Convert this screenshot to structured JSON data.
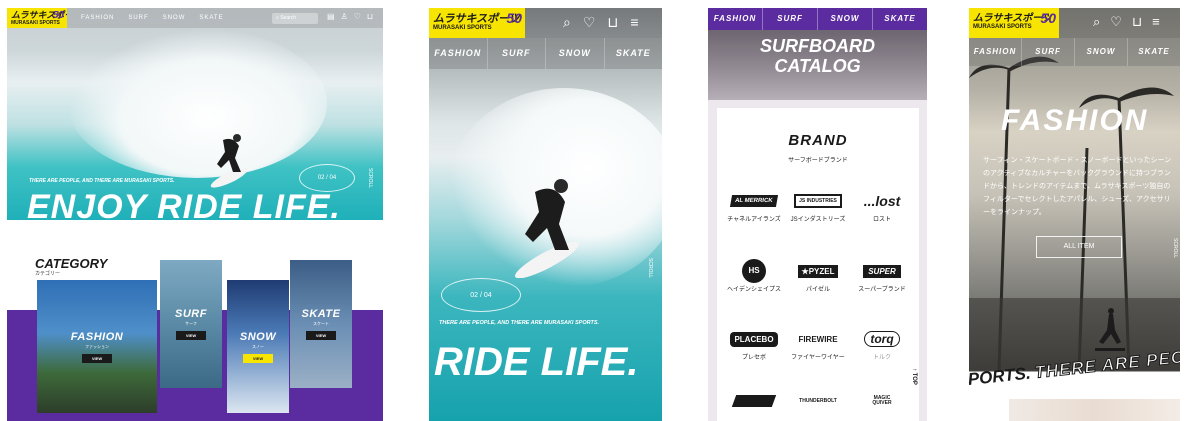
{
  "logo": {
    "jp": "ムラサキスポーツ",
    "en": "MURASAKI SPORTS",
    "anniv": "50"
  },
  "colors": {
    "brand_yellow": "#f7e400",
    "brand_purple": "#5b2ca0",
    "ocean": "#1fb0b9"
  },
  "desktop": {
    "nav": [
      "FASHION",
      "SURF",
      "SNOW",
      "SKATE"
    ],
    "search_placeholder": "Search",
    "tagline": "THERE ARE PEOPLE, AND THERE ARE MURASAKI SPORTS.",
    "headline": "ENJOY RIDE LIFE.",
    "pager": "02 / 04",
    "scroll": "SCROLL",
    "category": {
      "title": "CATEGORY",
      "subtitle": "カテゴリー"
    },
    "cards": [
      {
        "name": "FASHION",
        "sub": "ファッション",
        "view": "VIEW"
      },
      {
        "name": "SURF",
        "sub": "サーフ",
        "view": "VIEW"
      },
      {
        "name": "SNOW",
        "sub": "スノー",
        "view": "VIEW"
      },
      {
        "name": "SKATE",
        "sub": "スケート",
        "view": "VIEW"
      }
    ]
  },
  "mobile_home": {
    "tabs": [
      "FASHION",
      "SURF",
      "SNOW",
      "SKATE"
    ],
    "pager": "02 / 04",
    "scroll": "SCROLL",
    "tagline": "THERE ARE PEOPLE, AND THERE ARE MURASAKI SPORTS.",
    "headline": "RIDE LIFE."
  },
  "catalog": {
    "tabs": [
      "FASHION",
      "SURF",
      "SNOW",
      "SKATE"
    ],
    "title_line1": "SURFBOARD",
    "title_line2": "CATALOG",
    "brand_title": "BRAND",
    "brand_subtitle": "サーフボードブランド",
    "brands": [
      {
        "logo": "AL MERRICK",
        "name": "チャネルアイランズ"
      },
      {
        "logo": "JS INDUSTRIES",
        "name": "JSインダストリーズ"
      },
      {
        "logo": "...lost",
        "name": "ロスト"
      },
      {
        "logo": "HS",
        "name": "ヘイデンシェイプス"
      },
      {
        "logo": "★PYZEL",
        "name": "パイゼル"
      },
      {
        "logo": "SUPER",
        "name": "スーパーブランド"
      },
      {
        "logo": "PLACEBO",
        "name": "プレセボ"
      },
      {
        "logo": "FIREWIRE",
        "name": "ファイヤーワイヤー"
      },
      {
        "logo": "torq",
        "name": "トルク"
      },
      {
        "logo": "",
        "name": ""
      },
      {
        "logo": "THUNDERBOLT",
        "name": ""
      },
      {
        "logo": "MAGIC QUIVER",
        "name": ""
      }
    ],
    "top_label": "TOP"
  },
  "fashion": {
    "tabs": [
      "FASHION",
      "SURF",
      "SNOW",
      "SKATE"
    ],
    "title": "FASHION",
    "description": "サーフィン・スケートボード・スノーボードといったシーンのアクティブなカルチャーをバックグラウンドに持つブランドから、トレンドのアイテムまで、ムラサキスポーツ独自のフィルターでセレクトしたアパレル、シューズ、アクセサリーをラインナップ。",
    "button": "ALL ITEM",
    "scroll": "SCROLL",
    "ticker_solid": "PORTS.",
    "ticker_outline": "THERE ARE PEO"
  }
}
